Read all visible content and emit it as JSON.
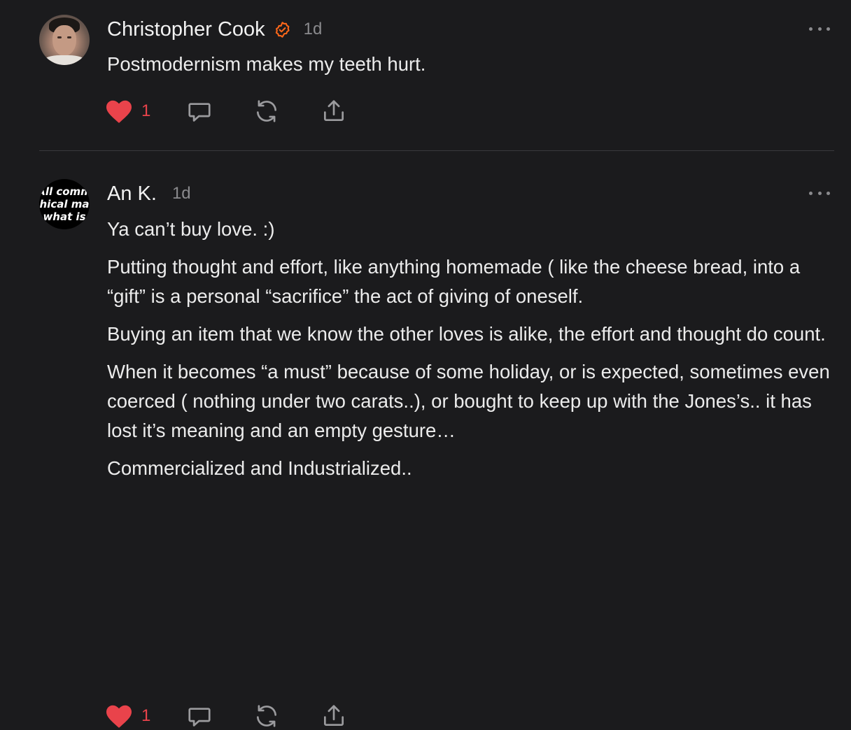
{
  "posts": [
    {
      "author": "Christopher Cook",
      "verified": true,
      "time": "1d",
      "avatar": {
        "type": "photo"
      },
      "paragraphs": [
        "Postmodernism makes my teeth hurt."
      ],
      "likes": "1"
    },
    {
      "author": "An K.",
      "verified": false,
      "time": "1d",
      "avatar": {
        "type": "text",
        "lines": [
          "All comm",
          "hical ma",
          "what is"
        ]
      },
      "paragraphs": [
        "Ya can’t buy love. :)",
        "Putting thought and effort, like anything homemade ( like the cheese bread, into a “gift” is a personal “sacrifice” the act of giving of oneself.",
        "Buying an item that we know the other loves is alike, the effort and thought do count.",
        "When it becomes “a must” because of some holiday, or is expected, sometimes even coerced ( nothing under two carats..), or bought to keep up with the Jones’s.. it has lost it’s meaning and an empty gesture…",
        "Commercialized and Industrialized.."
      ],
      "likes": "1"
    }
  ],
  "icons": {
    "verified": "verified-badge-icon",
    "more": "more-options-icon",
    "like": "heart-icon",
    "comment": "comment-bubble-icon",
    "restack": "restack-icon",
    "share": "share-icon"
  },
  "colors": {
    "background": "#1b1b1d",
    "text": "#ececec",
    "muted": "#8a8a8d",
    "like": "#e9434b",
    "verified": "#ff6719",
    "divider": "#3a3a3d"
  }
}
